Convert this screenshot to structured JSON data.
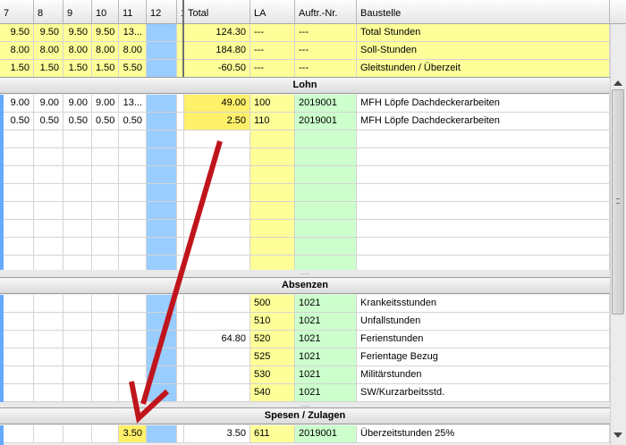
{
  "columns": [
    "7",
    "8",
    "9",
    "10",
    "11",
    "12",
    "1",
    "Total",
    "LA",
    "Auftr.-Nr.",
    "Baustelle"
  ],
  "summary_rows": [
    {
      "days": [
        "9.50",
        "9.50",
        "9.50",
        "9.50",
        "13...",
        ""
      ],
      "total": "124.30",
      "la": "---",
      "auftr": "---",
      "baustelle": "Total Stunden"
    },
    {
      "days": [
        "8.00",
        "8.00",
        "8.00",
        "8.00",
        "8.00",
        ""
      ],
      "total": "184.80",
      "la": "---",
      "auftr": "---",
      "baustelle": "Soll-Stunden"
    },
    {
      "days": [
        "1.50",
        "1.50",
        "1.50",
        "1.50",
        "5.50",
        ""
      ],
      "total": "-60.50",
      "la": "---",
      "auftr": "---",
      "baustelle": "Gleitstunden / Überzeit"
    }
  ],
  "lohn": {
    "title": "Lohn",
    "rows": [
      {
        "days": [
          "9.00",
          "9.00",
          "9.00",
          "9.00",
          "13...",
          ""
        ],
        "total": "49.00",
        "la": "100",
        "auftr": "2019001",
        "baustelle": "MFH Löpfe Dachdeckerarbeiten"
      },
      {
        "days": [
          "0.50",
          "0.50",
          "0.50",
          "0.50",
          "0.50",
          ""
        ],
        "total": "2.50",
        "la": "110",
        "auftr": "2019001",
        "baustelle": "MFH Löpfe Dachdeckerarbeiten"
      }
    ]
  },
  "absenzen": {
    "title": "Absenzen",
    "rows": [
      {
        "total": "",
        "la": "500",
        "auftr": "1021",
        "baustelle": "Krankeitsstunden"
      },
      {
        "total": "",
        "la": "510",
        "auftr": "1021",
        "baustelle": "Unfallstunden"
      },
      {
        "total": "64.80",
        "la": "520",
        "auftr": "1021",
        "baustelle": "Ferienstunden"
      },
      {
        "total": "",
        "la": "525",
        "auftr": "1021",
        "baustelle": "Ferientage Bezug"
      },
      {
        "total": "",
        "la": "530",
        "auftr": "1021",
        "baustelle": "Militärstunden"
      },
      {
        "total": "",
        "la": "540",
        "auftr": "1021",
        "baustelle": "SW/Kurzarbeitsstd."
      }
    ]
  },
  "spesen": {
    "title": "Spesen / Zulagen",
    "rows": [
      {
        "day11": "3.50",
        "total": "3.50",
        "la": "611",
        "auftr": "2019001",
        "baustelle": "Überzeitstunden 25%"
      }
    ]
  },
  "splitter_text": ".....",
  "icons": {
    "scroll_up": "scroll-up-arrow-icon",
    "scroll_down": "scroll-down-arrow-icon"
  },
  "colors": {
    "total_yellow": "#ffff99",
    "highlight": "#fff06a",
    "weekend_blue": "#99ccff",
    "auftr_green": "#ccffcc",
    "arrow": "#c0141c"
  }
}
